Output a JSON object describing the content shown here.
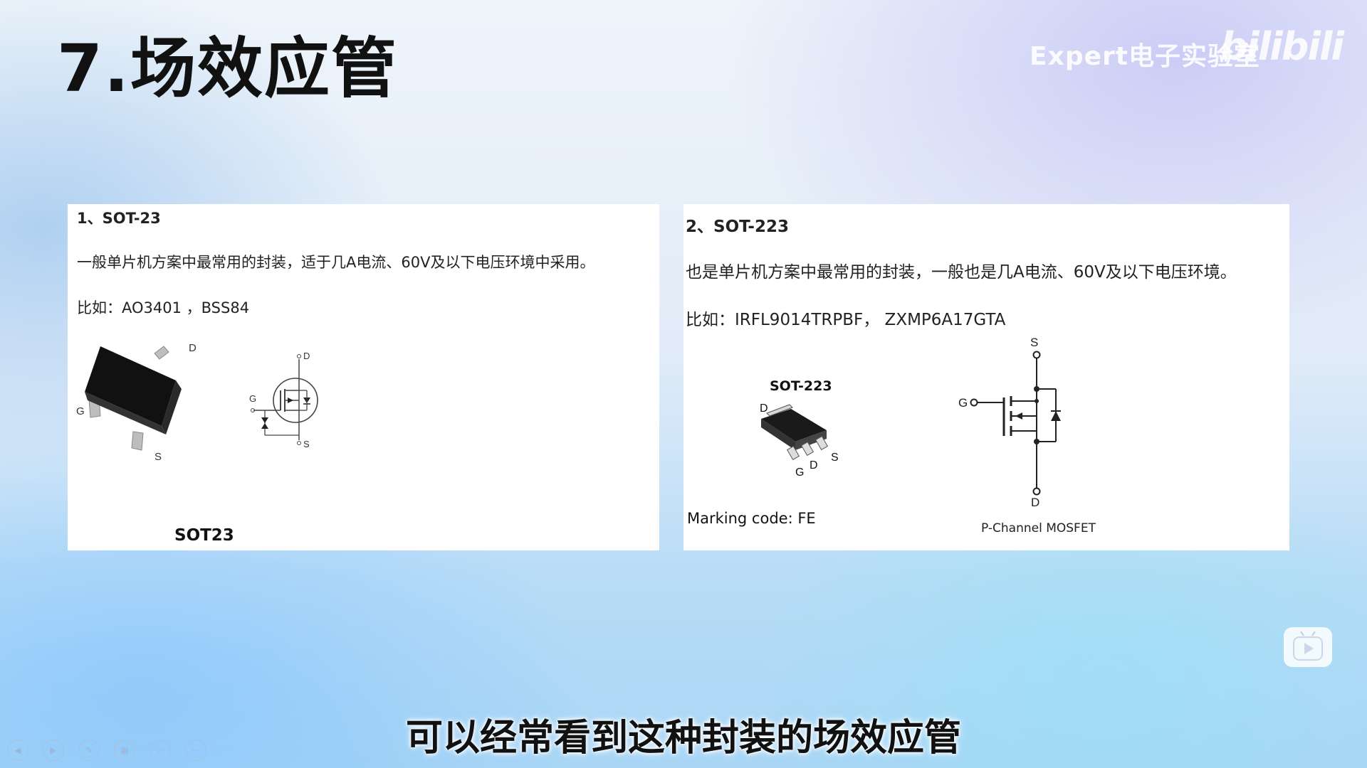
{
  "slide": {
    "title": "7.场效应管",
    "watermark": "Expert电子实验室",
    "bili_logo": "bilibili",
    "subtitle": "可以经常看到这种封装的场效应管"
  },
  "panel1": {
    "heading": "1、SOT-23",
    "desc": "一般单片机方案中最常用的封装，适于几A电流、60V及以下电压环境中采用。",
    "example": "比如：AO3401 ，BSS84",
    "pkg_label": "SOT23",
    "pin_d": "D",
    "pin_g": "G",
    "pin_s": "S",
    "sym_d": "D",
    "sym_g": "G",
    "sym_s": "S"
  },
  "panel2": {
    "heading": "2、SOT-223",
    "desc": "也是单片机方案中最常用的封装，一般也是几A电流、60V及以下电压环境。",
    "example": "比如：IRFL9014TRPBF， ZXMP6A17GTA",
    "pkg_title": "SOT-223",
    "pin_d_top": "D",
    "pin_g": "G",
    "pin_d": "D",
    "pin_s": "S",
    "marking": "Marking code: FE",
    "sym_s": "S",
    "sym_g": "G",
    "sym_d": "D",
    "sym_caption": "P-Channel MOSFET"
  },
  "controls": {
    "items": [
      "prev-icon",
      "next-icon",
      "pen-icon",
      "grid-icon",
      "zoom-icon",
      "more-icon"
    ],
    "more_label": "···"
  },
  "colors": {
    "panel_bg": "#ffffff",
    "title": "#111111",
    "watermark": "#ffffff"
  }
}
